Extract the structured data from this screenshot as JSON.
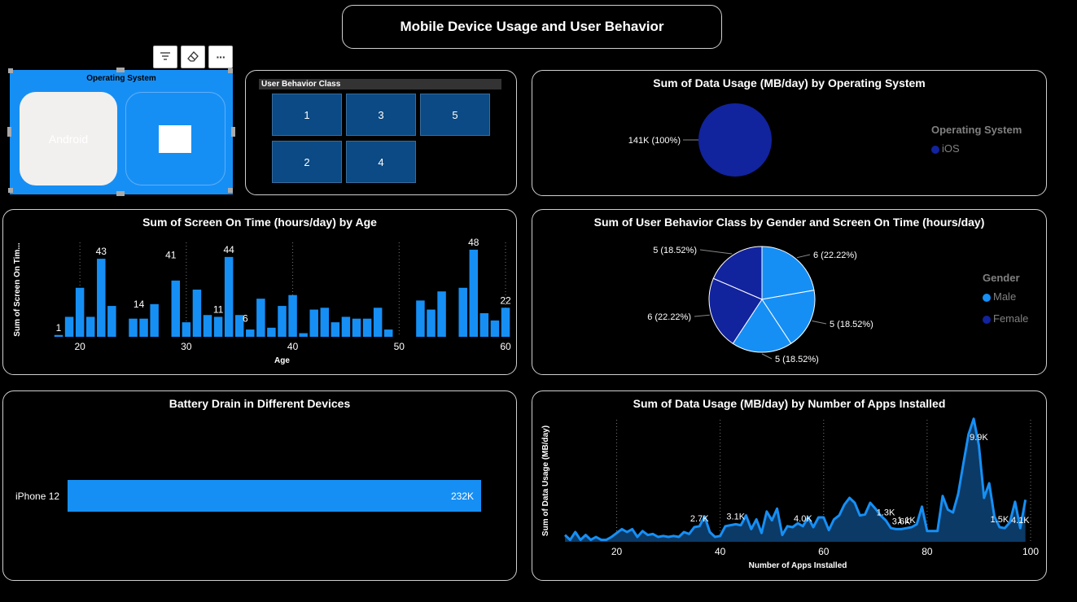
{
  "dashboard": {
    "title": "Mobile Device Usage and User Behavior"
  },
  "os_slicer": {
    "title": "Operating System",
    "options": [
      "Android",
      ""
    ]
  },
  "toolbar": {
    "filter_icon": "filter-icon",
    "eraser_icon": "eraser-icon",
    "more_label": "···"
  },
  "behavior_slicer": {
    "title": "User Behavior Class",
    "options": [
      "1",
      "3",
      "5",
      "2",
      "4"
    ]
  },
  "colors": {
    "blue": "#168ff5",
    "navy": "#12239e",
    "dark_blue_fill": "#0b4a84",
    "card_border": "#cfcfcf",
    "grey_text": "#808080"
  },
  "chart_data": [
    {
      "id": "pie_os",
      "type": "pie",
      "title": "Sum of Data Usage (MB/day) by Operating System",
      "legend_title": "Operating System",
      "legend_position": "right",
      "slices": [
        {
          "label": "iOS",
          "value": 141000,
          "display": "141K (100%)",
          "color": "#12239e"
        }
      ]
    },
    {
      "id": "bar_age",
      "type": "bar",
      "title": "Sum of Screen On Time (hours/day) by Age",
      "xlabel": "Age",
      "ylabel": "Sum of Screen On Tim...",
      "x_ticks": [
        20,
        30,
        40,
        50,
        60
      ],
      "xlim": [
        18,
        60
      ],
      "ylim": [
        0,
        52
      ],
      "points": [
        {
          "x": 18,
          "y": 1,
          "label": "1"
        },
        {
          "x": 19,
          "y": 11
        },
        {
          "x": 20,
          "y": 27
        },
        {
          "x": 21,
          "y": 11
        },
        {
          "x": 22,
          "y": 43,
          "label": "43"
        },
        {
          "x": 23,
          "y": 17
        },
        {
          "x": 25,
          "y": 10
        },
        {
          "x": 26,
          "y": 10
        },
        {
          "x": 27,
          "y": 18
        },
        {
          "x": 29,
          "y": 31
        },
        {
          "x": 30,
          "y": 8
        },
        {
          "x": 31,
          "y": 26
        },
        {
          "x": 32,
          "y": 12
        },
        {
          "x": 33,
          "y": 11,
          "label": "11"
        },
        {
          "x": 34,
          "y": 44,
          "label": "44"
        },
        {
          "x": 35,
          "y": 12
        },
        {
          "x": 36,
          "y": 4
        },
        {
          "x": 37,
          "y": 21
        },
        {
          "x": 38,
          "y": 5
        },
        {
          "x": 39,
          "y": 17
        },
        {
          "x": 40,
          "y": 23
        },
        {
          "x": 41,
          "y": 2
        },
        {
          "x": 42,
          "y": 15
        },
        {
          "x": 43,
          "y": 16
        },
        {
          "x": 44,
          "y": 8
        },
        {
          "x": 45,
          "y": 11
        },
        {
          "x": 46,
          "y": 10
        },
        {
          "x": 47,
          "y": 10
        },
        {
          "x": 48,
          "y": 16
        },
        {
          "x": 49,
          "y": 4
        },
        {
          "x": 52,
          "y": 20
        },
        {
          "x": 53,
          "y": 15
        },
        {
          "x": 54,
          "y": 25
        },
        {
          "x": 56,
          "y": 27
        },
        {
          "x": 57,
          "y": 48,
          "label": "48"
        },
        {
          "x": 58,
          "y": 13
        },
        {
          "x": 59,
          "y": 9
        },
        {
          "x": 60,
          "y": 16,
          "label": "22"
        }
      ],
      "extra_labels": [
        {
          "x": 26,
          "text": "14",
          "y": 14
        },
        {
          "x": 29,
          "text": "41",
          "y": 41
        },
        {
          "x": 36,
          "text": "6",
          "y": 6
        }
      ]
    },
    {
      "id": "pie_gender",
      "type": "pie",
      "title": "Sum of User Behavior Class by Gender and Screen On Time (hours/day)",
      "legend_title": "Gender",
      "legend_position": "right",
      "legend": [
        {
          "label": "Male",
          "color": "#168ff5"
        },
        {
          "label": "Female",
          "color": "#12239e"
        }
      ],
      "slices": [
        {
          "value": 6,
          "display": "6 (22.22%)",
          "color": "#168ff5"
        },
        {
          "value": 5,
          "display": "5 (18.52%)",
          "color": "#168ff5"
        },
        {
          "value": 5,
          "display": "5 (18.52%)",
          "color": "#168ff5"
        },
        {
          "value": 6,
          "display": "6 (22.22%)",
          "color": "#12239e"
        },
        {
          "value": 5,
          "display": "5 (18.52%)",
          "color": "#12239e"
        }
      ]
    },
    {
      "id": "bar_battery",
      "type": "bar",
      "orientation": "horizontal",
      "title": "Battery Drain in Different Devices",
      "categories": [
        "iPhone 12"
      ],
      "values": [
        232000
      ],
      "value_labels": [
        "232K"
      ]
    },
    {
      "id": "area_apps",
      "type": "area",
      "title": "Sum of Data Usage (MB/day) by Number of Apps Installed",
      "xlabel": "Number of Apps Installed",
      "ylabel": "Sum of Data Usage (MB/day)",
      "x_ticks": [
        20,
        40,
        60,
        80,
        100
      ],
      "xlim": [
        10,
        100
      ],
      "ylim": [
        0,
        12500
      ],
      "x": [
        10,
        11,
        12,
        13,
        14,
        15,
        16,
        17,
        18,
        19,
        20,
        21,
        22,
        23,
        24,
        25,
        26,
        27,
        28,
        29,
        30,
        31,
        32,
        33,
        34,
        35,
        36,
        37,
        38,
        39,
        40,
        41,
        42,
        43,
        44,
        45,
        46,
        47,
        48,
        49,
        50,
        51,
        52,
        53,
        54,
        55,
        56,
        57,
        58,
        59,
        60,
        61,
        62,
        63,
        64,
        65,
        66,
        67,
        68,
        69,
        70,
        71,
        72,
        73,
        74,
        75,
        76,
        77,
        78,
        79,
        80,
        81,
        82,
        83,
        84,
        85,
        86,
        87,
        88,
        89,
        90,
        91,
        92,
        93,
        94,
        95,
        96,
        97,
        98,
        99
      ],
      "y": [
        700,
        200,
        1000,
        200,
        700,
        200,
        500,
        200,
        200,
        500,
        900,
        1300,
        1000,
        1300,
        500,
        1100,
        700,
        800,
        500,
        600,
        500,
        600,
        500,
        1000,
        800,
        1500,
        1600,
        2600,
        1000,
        500,
        600,
        1600,
        1700,
        1800,
        1700,
        2700,
        1300,
        2300,
        900,
        3100,
        2200,
        3400,
        700,
        1600,
        1500,
        1900,
        1600,
        2500,
        1500,
        2500,
        2500,
        1200,
        2300,
        2700,
        3800,
        4500,
        4000,
        2700,
        2800,
        4000,
        3400,
        2700,
        2200,
        1400,
        1300,
        1300,
        1400,
        1500,
        1800,
        3600,
        1100,
        1100,
        1100,
        4700,
        3300,
        3000,
        4900,
        8000,
        11000,
        12600,
        9900,
        4500,
        6000,
        2600,
        1500,
        1400,
        2000,
        4100,
        1400,
        4300
      ],
      "labels": [
        {
          "x": 36,
          "text": "2.7K"
        },
        {
          "x": 43,
          "text": "3.1K"
        },
        {
          "x": 56,
          "text": "4.0K"
        },
        {
          "x": 72,
          "text": "1.3K"
        },
        {
          "x": 75,
          "text": "3.6K"
        },
        {
          "x": 76,
          "text": "1.1K"
        },
        {
          "x": 90,
          "text": "9.9K"
        },
        {
          "x": 94,
          "text": "1.5K"
        },
        {
          "x": 98,
          "text": "4.1K"
        }
      ]
    }
  ]
}
